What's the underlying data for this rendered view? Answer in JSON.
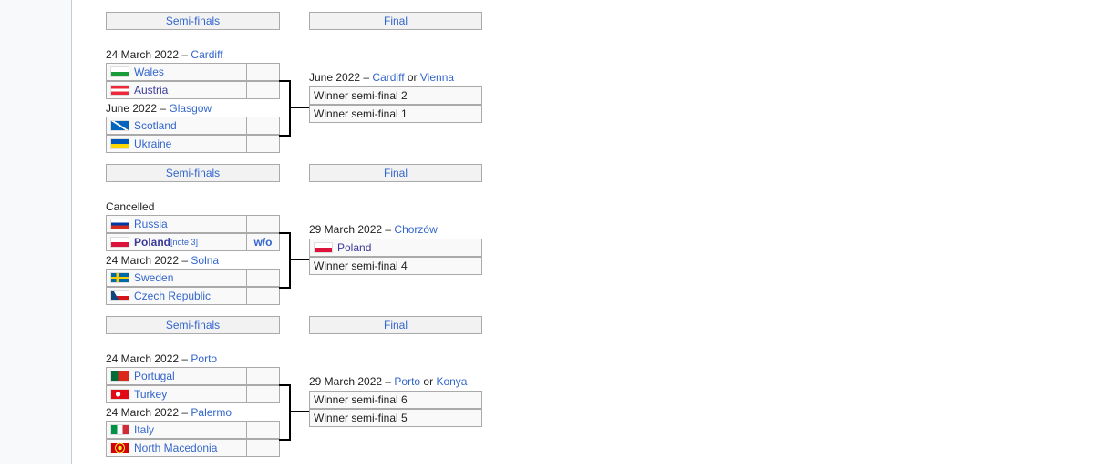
{
  "brackets": [
    {
      "semi_label": "Semi-finals",
      "final_label": "Final",
      "sf1": {
        "date": "24 March 2022 – ",
        "venue": "Cardiff",
        "teams": [
          {
            "name": "Wales",
            "flag": "wales-flag",
            "score": ""
          },
          {
            "name": "Austria",
            "flag": "austria-flag",
            "score": ""
          }
        ]
      },
      "sf2": {
        "date": "June 2022 – ",
        "venue": "Glasgow",
        "teams": [
          {
            "name": "Scotland",
            "flag": "scotland-flag",
            "score": ""
          },
          {
            "name": "Ukraine",
            "flag": "ukraine-flag",
            "score": ""
          }
        ]
      },
      "final": {
        "date": "June 2022 – ",
        "venue": "Cardiff",
        "or": " or ",
        "venue2": "Vienna",
        "teams": [
          {
            "name": "Winner semi-final 2"
          },
          {
            "name": "Winner semi-final 1"
          }
        ]
      }
    },
    {
      "semi_label": "Semi-finals",
      "final_label": "Final",
      "sf1": {
        "date": "Cancelled",
        "teams": [
          {
            "name": "Russia",
            "flag": "russia-flag",
            "score": ""
          },
          {
            "name": "Poland",
            "note": "[note 3]",
            "flag": "poland-flag",
            "score": "w/o"
          }
        ]
      },
      "sf2": {
        "date": "24 March 2022 – ",
        "venue": "Solna",
        "teams": [
          {
            "name": "Sweden",
            "flag": "sweden-flag",
            "score": ""
          },
          {
            "name": "Czech Republic",
            "flag": "czech-flag",
            "score": ""
          }
        ]
      },
      "final": {
        "date": "29 March 2022 – ",
        "venue": "Chorzów",
        "teams": [
          {
            "name": "Poland",
            "flag": "poland-flag"
          },
          {
            "name": "Winner semi-final 4"
          }
        ]
      }
    },
    {
      "semi_label": "Semi-finals",
      "final_label": "Final",
      "sf1": {
        "date": "24 March 2022 – ",
        "venue": "Porto",
        "teams": [
          {
            "name": "Portugal",
            "flag": "portugal-flag",
            "score": ""
          },
          {
            "name": "Turkey",
            "flag": "turkey-flag",
            "score": ""
          }
        ]
      },
      "sf2": {
        "date": "24 March 2022 – ",
        "venue": "Palermo",
        "teams": [
          {
            "name": "Italy",
            "flag": "italy-flag",
            "score": ""
          },
          {
            "name": "North Macedonia",
            "flag": "north-macedonia-flag",
            "score": ""
          }
        ]
      },
      "final": {
        "date": "29 March 2022 – ",
        "venue": "Porto",
        "or": " or ",
        "venue2": "Konya",
        "teams": [
          {
            "name": "Winner semi-final 6"
          },
          {
            "name": "Winner semi-final 5"
          }
        ]
      }
    }
  ]
}
